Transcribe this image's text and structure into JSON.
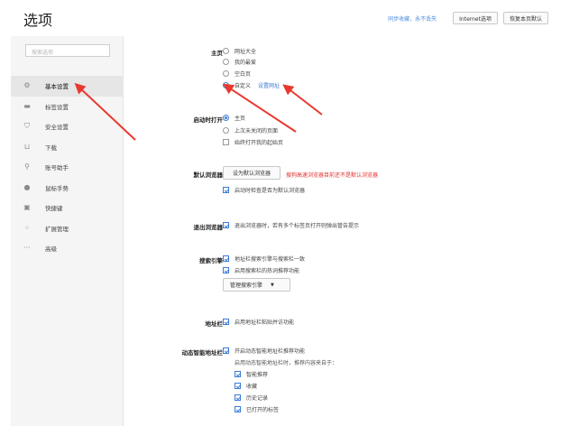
{
  "header": {
    "title": "选项",
    "sync_link": "同步收藏，永不丢失",
    "internet_options": "Internet选项",
    "restore_defaults": "恢复本页默认"
  },
  "sidebar": {
    "search_placeholder": "搜索选项",
    "items": [
      {
        "label": "基本设置",
        "icon": "gear-icon"
      },
      {
        "label": "标签设置",
        "icon": "tab-icon"
      },
      {
        "label": "安全设置",
        "icon": "shield-icon"
      },
      {
        "label": "下载",
        "icon": "download-icon"
      },
      {
        "label": "账号助手",
        "icon": "key-icon"
      },
      {
        "label": "鼠标手势",
        "icon": "mouse-icon"
      },
      {
        "label": "快捷键",
        "icon": "keyboard-icon"
      },
      {
        "label": "扩展管理",
        "icon": "grid-icon"
      },
      {
        "label": "高级",
        "icon": "more-icon"
      }
    ]
  },
  "homepage": {
    "label": "主页",
    "options": [
      "网址大全",
      "我的最爱",
      "空白页",
      "自定义"
    ],
    "selected": "自定义",
    "set_link": "设置网址"
  },
  "startup": {
    "label": "启动时打开",
    "options": [
      "主页",
      "上次未关闭的页面"
    ],
    "selected": "主页",
    "always_open_label": "始终打开我的起始页"
  },
  "default_browser": {
    "label": "默认浏览器",
    "button": "设为默认浏览器",
    "warning": "搜狗高速浏览器目前还不是默认浏览器",
    "check_label": "启动时检查是否为默认浏览器"
  },
  "exit_browser": {
    "label": "退出浏览器",
    "check_label": "退出浏览器时，若有多个标签页打开则弹出管告提示"
  },
  "search_engine": {
    "label": "搜索引擎",
    "check1": "地址栏搜索引擎与搜索栏一致",
    "check2": "启用搜索栏的热词推荐功能",
    "manage_button": "管理搜索引擎"
  },
  "address_bar": {
    "label": "地址栏",
    "check_label": "启用地址栏粘贴并访功能"
  },
  "smart_bar": {
    "label": "动态智能地址栏",
    "check_label": "开启动态智能地址栏推荐功能",
    "note": "启用动态智能地址栏时，推荐内容来自于：",
    "sources": [
      "智能推荐",
      "收藏",
      "历史记录",
      "已打开的标签"
    ]
  },
  "colors": {
    "accent": "#3a7bd5",
    "warning": "#e0312e",
    "arrow": "#e8392f"
  }
}
